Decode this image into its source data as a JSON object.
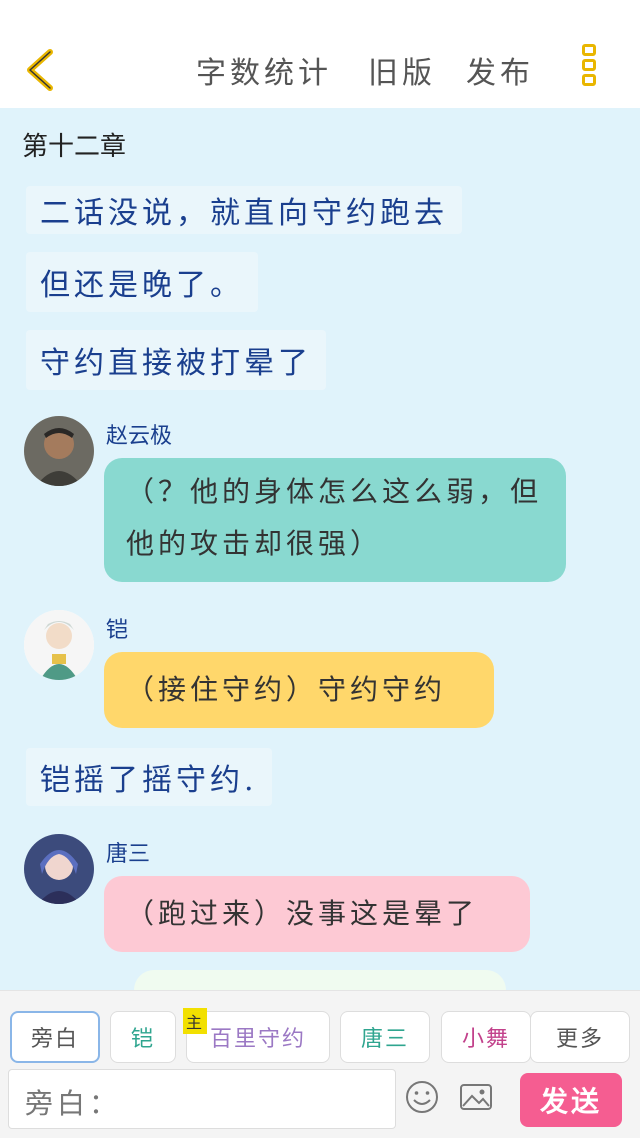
{
  "topbar": {
    "word_count": "字数统计",
    "old_version": "旧版",
    "publish": "发布"
  },
  "chapter_title": "第十二章",
  "messages": [
    {
      "type": "narration",
      "text": "二话没说，就直向守约跑去"
    },
    {
      "type": "narration",
      "text": "但还是晚了。"
    },
    {
      "type": "narration",
      "text": "守约直接被打晕了"
    },
    {
      "type": "speech",
      "speaker": "赵云极",
      "text": "（？他的身体怎么这么弱，但他的攻击却很强）",
      "color": "#89d9d0"
    },
    {
      "type": "speech",
      "speaker": "铠",
      "text": "（接住守约）守约守约",
      "color": "#ffd76b"
    },
    {
      "type": "narration",
      "text": "铠摇了摇守约."
    },
    {
      "type": "speech",
      "speaker": "唐三",
      "text": "（跑过来）没事这是晕了",
      "color": "#fdc9d4"
    }
  ],
  "characters": [
    {
      "label": "旁白",
      "color": "#555555",
      "active": true
    },
    {
      "label": "铠",
      "color": "#2fa58f"
    },
    {
      "label": "百里守约",
      "color": "#9b78c4",
      "badge": "主"
    },
    {
      "label": "唐三",
      "color": "#2fa58f"
    },
    {
      "label": "小舞",
      "color": "#c2418b"
    },
    {
      "label": "更多",
      "color": "#555555"
    }
  ],
  "input": {
    "prefix": "旁白："
  },
  "send_label": "发送",
  "colors": {
    "accent": "#f55d91",
    "back_arrow": "#e9b600",
    "narration_text": "#1a3f8e",
    "content_bg": "#e0f3fb"
  }
}
